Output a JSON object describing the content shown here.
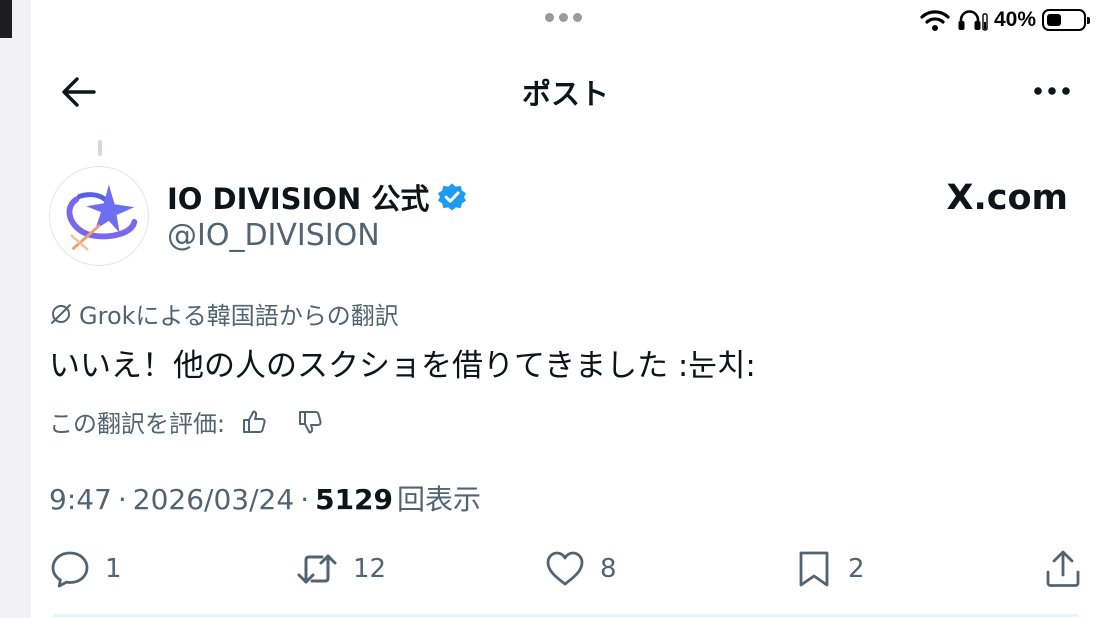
{
  "status_bar": {
    "battery_percent": "40%",
    "battery_level": 0.4
  },
  "nav": {
    "title": "ポスト"
  },
  "post": {
    "display_name": "IO DIVISION 公式",
    "handle": "@IO_DIVISION",
    "watermark": "X.com",
    "translation_label": "Grokによる韓国語からの翻訳",
    "text": "いいえ！他の人のスクショを借りてきました :눈치:",
    "rate_label": "この翻訳を評価:",
    "time": "9:47",
    "separator": "·",
    "date": "2026/03/24",
    "views_count": "5129",
    "views_label": "回表示"
  },
  "actions": {
    "reply_count": "1",
    "repost_count": "12",
    "like_count": "8",
    "bookmark_count": "2"
  },
  "icons": [
    "wifi-icon",
    "headphones-icon",
    "battery-icon",
    "back-arrow-icon",
    "more-icon",
    "verified-badge-icon",
    "grok-icon",
    "thumbs-up-icon",
    "thumbs-down-icon",
    "reply-icon",
    "repost-icon",
    "like-icon",
    "bookmark-icon",
    "share-icon"
  ],
  "colors": {
    "verified": "#1d9bf0",
    "secondary_text": "#536471",
    "primary_text": "#0f1419"
  }
}
